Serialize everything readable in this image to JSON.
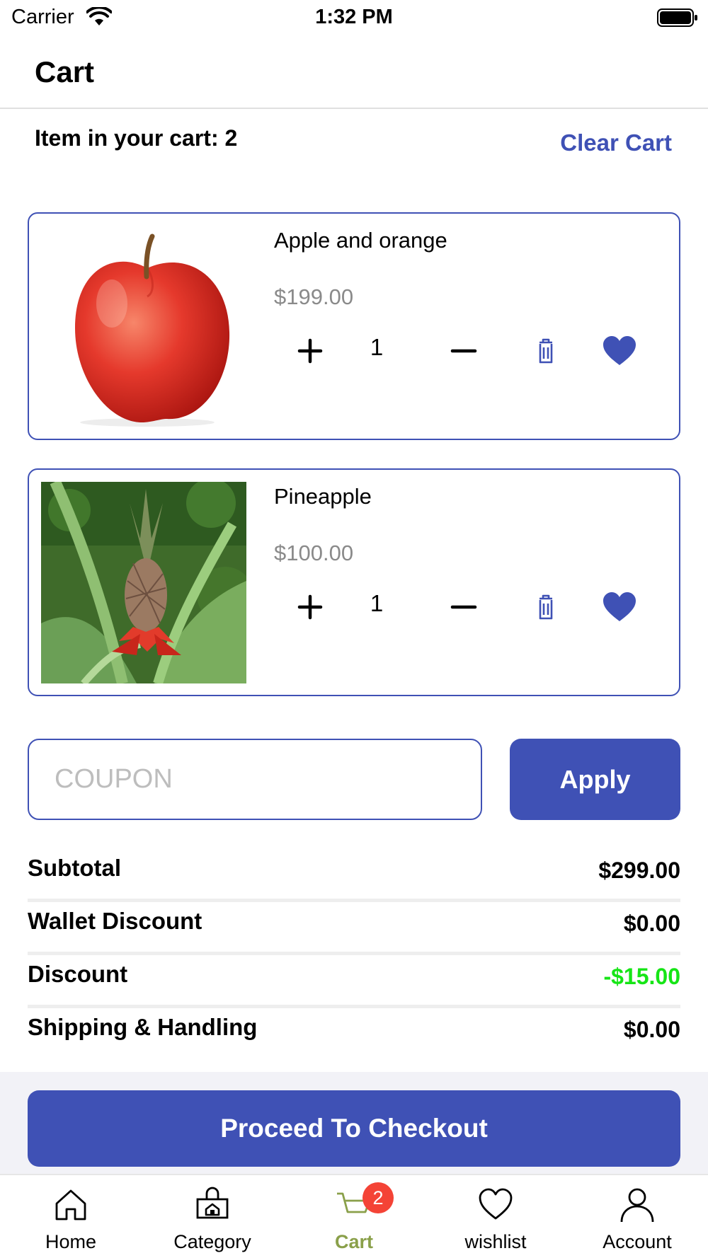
{
  "status_bar": {
    "carrier": "Carrier",
    "time": "1:32 PM"
  },
  "header": {
    "title": "Cart"
  },
  "cart_summary": {
    "count_text": "Item in your cart: 2",
    "clear_label": "Clear Cart"
  },
  "items": [
    {
      "name": "Apple and orange",
      "price": "$199.00",
      "quantity": "1",
      "image": "apple"
    },
    {
      "name": "Pineapple",
      "price": "$100.00",
      "quantity": "1",
      "image": "pineapple"
    }
  ],
  "coupon": {
    "placeholder": "COUPON",
    "value": "",
    "apply_label": "Apply"
  },
  "totals": [
    {
      "label": "Subtotal",
      "value": "$299.00"
    },
    {
      "label": "Wallet Discount",
      "value": "$0.00"
    },
    {
      "label": "Discount",
      "value": "-$15.00"
    },
    {
      "label": "Shipping & Handling",
      "value": "$0.00"
    }
  ],
  "checkout_label": "Proceed To Checkout",
  "tabs": [
    {
      "label": "Home",
      "icon": "home-icon"
    },
    {
      "label": "Category",
      "icon": "category-icon"
    },
    {
      "label": "Cart",
      "icon": "cart-icon",
      "badge": "2",
      "active": true
    },
    {
      "label": "wishlist",
      "icon": "heart-icon"
    },
    {
      "label": "Account",
      "icon": "user-icon"
    }
  ],
  "colors": {
    "accent": "#3f51b5",
    "active_tab": "#8aa04a",
    "discount": "#16e516",
    "badge": "#f44336",
    "price": "#8a8a8a"
  }
}
